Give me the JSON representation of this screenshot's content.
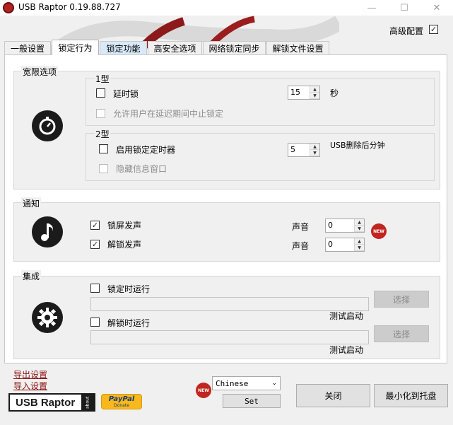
{
  "window": {
    "title": "USB Raptor 0.19.88.727",
    "minimize": "—",
    "maximize": "☐",
    "close": "✕"
  },
  "advanced": {
    "label": "高级配置",
    "checked": true
  },
  "tabs": [
    {
      "label": "一般设置"
    },
    {
      "label": "锁定行为"
    },
    {
      "label": "锁定功能"
    },
    {
      "label": "高安全选项"
    },
    {
      "label": "网络锁定同步"
    },
    {
      "label": "解锁文件设置"
    }
  ],
  "grace": {
    "title": "宽限选项",
    "type1": {
      "title": "1型",
      "delay_label": "延时锁",
      "delay_value": "15",
      "delay_unit": "秒",
      "allow_abort_label": "允许用户在延迟期间中止锁定"
    },
    "type2": {
      "title": "2型",
      "timer_label": "启用锁定定时器",
      "timer_value": "5",
      "timer_unit": "USB删除后分钟",
      "hide_info_label": "隐藏信息窗口"
    }
  },
  "notify": {
    "title": "通知",
    "lock_sound_label": "锁屏发声",
    "unlock_sound_label": "解锁发声",
    "sound_label_1": "声音",
    "sound_label_2": "声音",
    "sound_value_1": "0",
    "sound_value_2": "0",
    "new_badge": "NEW"
  },
  "integration": {
    "title": "集成",
    "run_on_lock_label": "锁定时运行",
    "run_on_unlock_label": "解锁时运行",
    "select_1": "选择",
    "select_2": "选择",
    "test_1": "测试启动",
    "test_2": "测试启动"
  },
  "footer": {
    "export_label": "导出设置",
    "import_label": "导入设置",
    "logo_text": "USB Raptor",
    "logo_about": "about",
    "paypal_text": "PayPal",
    "paypal_sub": "Donate",
    "new_badge": "NEW",
    "language": "Chinese",
    "set_label": "Set",
    "close_label": "关闭",
    "minimize_label": "最小化到托盘"
  }
}
